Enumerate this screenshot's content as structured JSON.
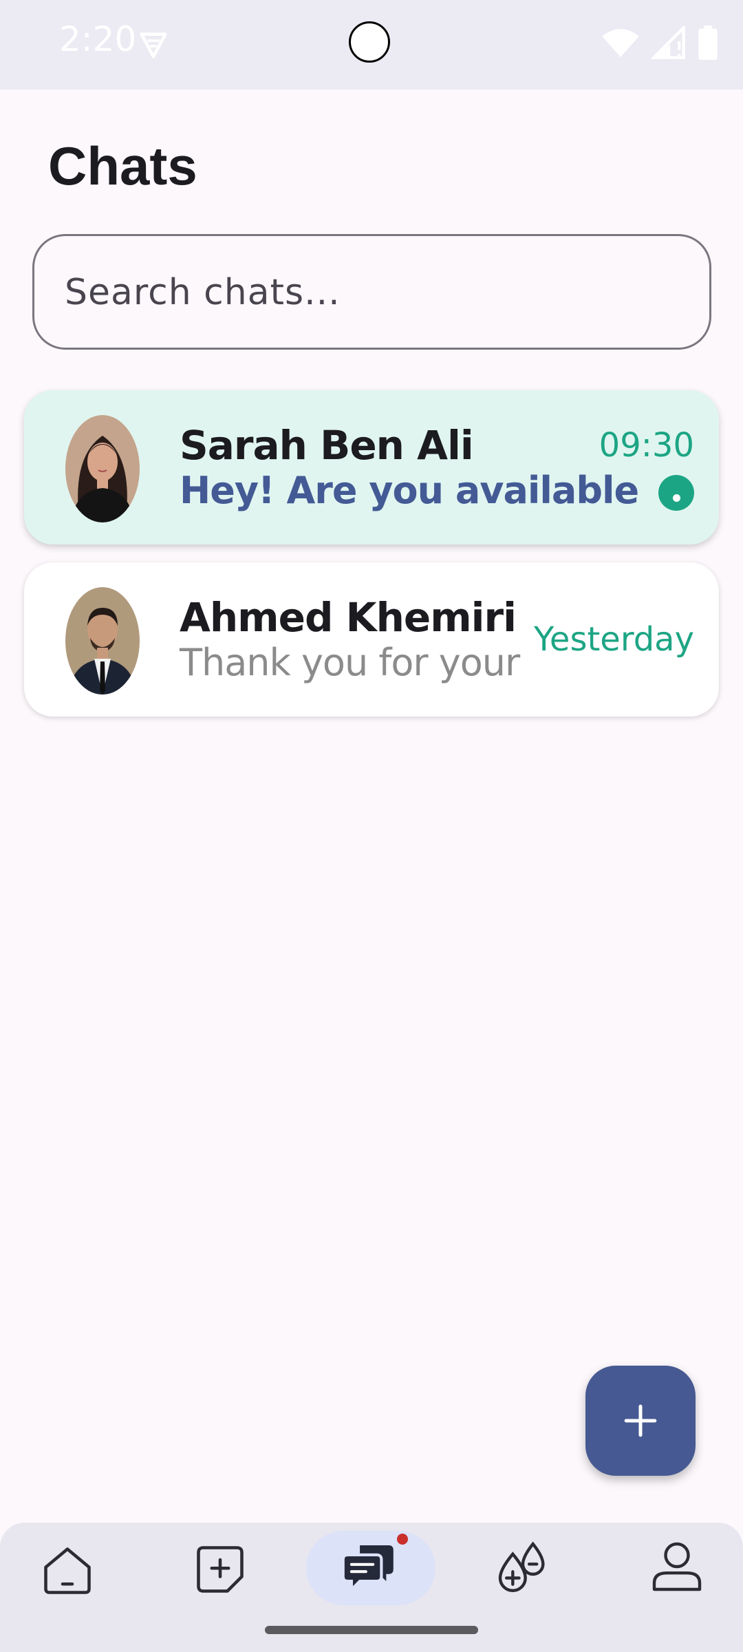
{
  "status_bar": {
    "time": "2:20",
    "icons": [
      "vpn-icon",
      "wifi-icon",
      "signal-icon",
      "battery-icon"
    ]
  },
  "page": {
    "title": "Chats"
  },
  "search": {
    "placeholder": "Search chats...",
    "value": ""
  },
  "chats": [
    {
      "name": "Sarah Ben Ali",
      "preview": "Hey! Are you available",
      "time": "09:30",
      "unread": true,
      "highlighted": true
    },
    {
      "name": "Ahmed Khemiri",
      "preview": "Thank you for your",
      "time": "Yesterday",
      "unread": false,
      "highlighted": false
    }
  ],
  "fab": {
    "icon": "plus-icon"
  },
  "bottom_nav": {
    "items": [
      {
        "icon": "home-icon",
        "active": false
      },
      {
        "icon": "add-note-icon",
        "active": false
      },
      {
        "icon": "chat-icon",
        "active": true,
        "badge": true
      },
      {
        "icon": "blood-drop-icon",
        "active": false
      },
      {
        "icon": "profile-icon",
        "active": false
      }
    ]
  },
  "colors": {
    "accent": "#465992",
    "teal": "#1ca584",
    "highlight_bg": "#e0f5f0",
    "badge": "#c9302c"
  }
}
